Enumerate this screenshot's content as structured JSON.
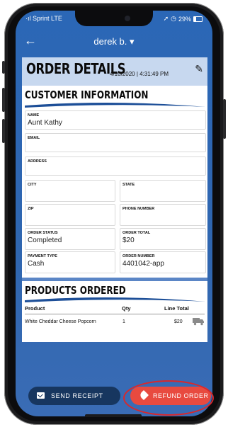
{
  "status_bar": {
    "carrier": "Sprint",
    "network": "LTE",
    "battery": "29%"
  },
  "header": {
    "back_icon": "arrow-left-icon",
    "user_name": "derek b.",
    "caret": "▾"
  },
  "order": {
    "title": "ORDER DETAILS",
    "datetime": "4/10/2020 | 4:31:49 PM",
    "customer_section_title": "CUSTOMER INFORMATION",
    "fields": {
      "name_label": "NAME",
      "name_value": "Aunt Kathy",
      "email_label": "EMAIL",
      "email_value": "",
      "address_label": "ADDRESS",
      "address_value": "",
      "city_label": "CITY",
      "city_value": "",
      "state_label": "STATE",
      "state_value": "",
      "zip_label": "ZIP",
      "zip_value": "",
      "phone_label": "PHONE NUMBER",
      "phone_value": "",
      "status_label": "ORDER STATUS",
      "status_value": "Completed",
      "total_label": "ORDER TOTAL",
      "total_value": "$20",
      "payment_label": "PAYMENT TYPE",
      "payment_value": "Cash",
      "number_label": "ORDER NUMBER",
      "number_value": "4401042-app"
    }
  },
  "products": {
    "title": "PRODUCTS ORDERED",
    "headers": {
      "product": "Product",
      "qty": "Qty",
      "line_total": "Line Total"
    },
    "rows": [
      {
        "product": "White Cheddar Cheese Popcorn",
        "qty": "1",
        "line_total": "$20"
      }
    ]
  },
  "actions": {
    "send_receipt": "SEND RECEIPT",
    "refund_order": "REFUND ORDER"
  },
  "colors": {
    "accent_blue": "#2b67b6",
    "refund_red": "#e84a3f",
    "navy": "#17365f"
  }
}
